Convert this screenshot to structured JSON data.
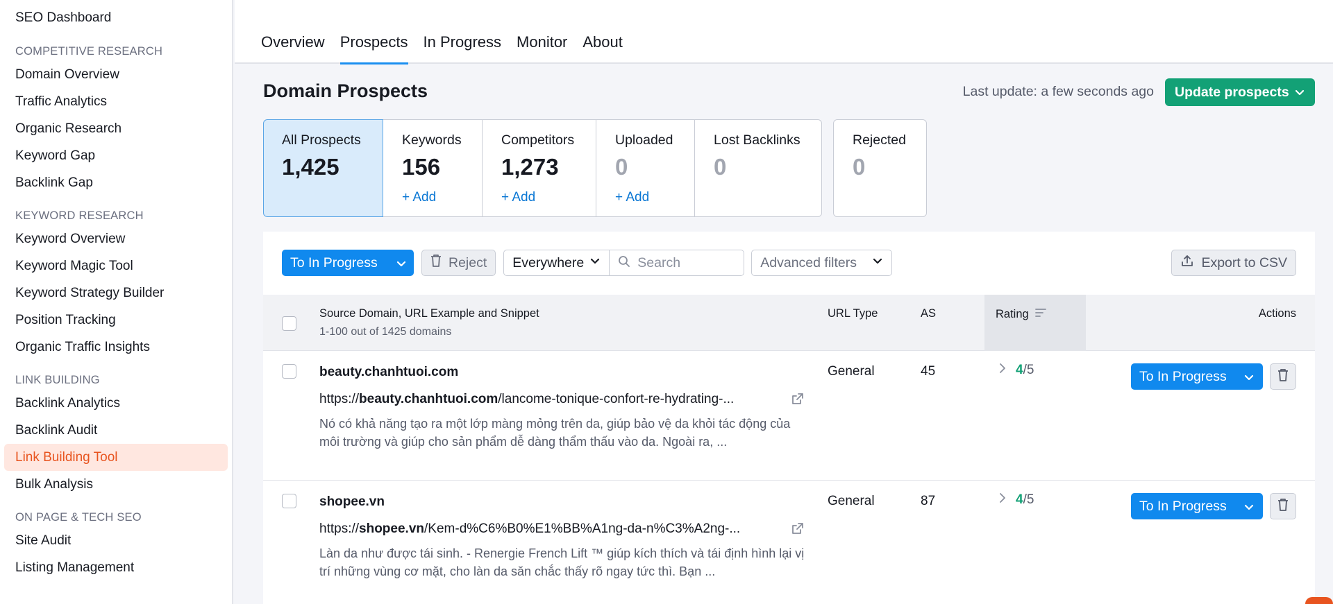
{
  "sidebar": {
    "top_item": "SEO Dashboard",
    "groups": [
      {
        "title": "COMPETITIVE RESEARCH",
        "items": [
          "Domain Overview",
          "Traffic Analytics",
          "Organic Research",
          "Keyword Gap",
          "Backlink Gap"
        ]
      },
      {
        "title": "KEYWORD RESEARCH",
        "items": [
          "Keyword Overview",
          "Keyword Magic Tool",
          "Keyword Strategy Builder",
          "Position Tracking",
          "Organic Traffic Insights"
        ]
      },
      {
        "title": "LINK BUILDING",
        "items": [
          "Backlink Analytics",
          "Backlink Audit",
          "Link Building Tool",
          "Bulk Analysis"
        ]
      },
      {
        "title": "ON PAGE & TECH SEO",
        "items": [
          "Site Audit",
          "Listing Management"
        ]
      }
    ],
    "active_item": "Link Building Tool"
  },
  "tabs": [
    "Overview",
    "Prospects",
    "In Progress",
    "Monitor",
    "About"
  ],
  "active_tab": "Prospects",
  "header": {
    "title": "Domain Prospects",
    "last_update": "Last update: a few seconds ago",
    "update_button": "Update prospects"
  },
  "cards": [
    {
      "label": "All Prospects",
      "value": "1,425",
      "add": ""
    },
    {
      "label": "Keywords",
      "value": "156",
      "add": "+ Add"
    },
    {
      "label": "Competitors",
      "value": "1,273",
      "add": "+ Add"
    },
    {
      "label": "Uploaded",
      "value": "0",
      "add": "+ Add"
    },
    {
      "label": "Lost Backlinks",
      "value": "0",
      "add": ""
    },
    {
      "label": "Rejected",
      "value": "0",
      "add": ""
    }
  ],
  "toolbar": {
    "to_in_progress": "To In Progress",
    "reject": "Reject",
    "scope": "Everywhere",
    "search_placeholder": "Search",
    "advanced_filters": "Advanced filters",
    "export": "Export to CSV"
  },
  "table": {
    "col_source": "Source Domain, URL Example and Snippet",
    "col_source_sub": "1-100 out of 1425 domains",
    "col_url_type": "URL Type",
    "col_as": "AS",
    "col_rating": "Rating",
    "col_actions": "Actions",
    "rows": [
      {
        "domain": "beauty.chanhtuoi.com",
        "url_prefix": "https://",
        "url_domain": "beauty.chanhtuoi.com",
        "url_path": "/lancome-tonique-confort-re-hydrating-...",
        "snippet": "Nó có khả năng tạo ra một lớp màng mỏng trên da, giúp bảo vệ da khỏi tác động của môi trường và giúp cho sản phẩm dễ dàng thẩm thấu vào da. Ngoài ra, ...",
        "url_type": "General",
        "as": "45",
        "rating_value": "4",
        "rating_max": "/5",
        "action": "To In Progress"
      },
      {
        "domain": "shopee.vn",
        "url_prefix": "https://",
        "url_domain": "shopee.vn",
        "url_path": "/Kem-d%C6%B0%E1%BB%A1ng-da-n%C3%A2ng-...",
        "snippet": "Làn da như được tái sinh. - Renergie French Lift ™ giúp kích thích và tái định hình lại vị trí những vùng cơ mặt, cho làn da săn chắc thấy rõ ngay tức thì. Bạn ...",
        "url_type": "General",
        "as": "87",
        "rating_value": "4",
        "rating_max": "/5",
        "action": "To In Progress"
      }
    ]
  },
  "colors": {
    "primary": "#1089ee",
    "green": "#13a176",
    "active_orange": "#e8541f"
  }
}
